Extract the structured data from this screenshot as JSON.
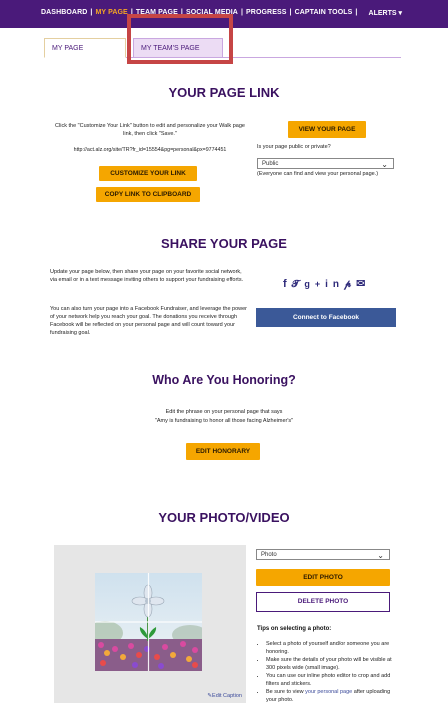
{
  "nav": {
    "items": [
      "DASHBOARD",
      "MY PAGE",
      "TEAM PAGE",
      "SOCIAL MEDIA",
      "PROGRESS",
      "CAPTAIN TOOLS"
    ],
    "alerts": "ALERTS ▾"
  },
  "tabs": [
    "MY PAGE",
    "MY TEAM'S PAGE"
  ],
  "page_link": {
    "title": "YOUR PAGE LINK",
    "instructions": "Click the \"Customize Your Link\" button to edit and personalize your Walk page link, then click \"Save.\"",
    "url": "http://act.alz.org/site/TR?fr_id=15554&pg=personal&px=9774451",
    "customize_btn": "CUSTOMIZE YOUR LINK",
    "copy_btn": "COPY LINK TO CLIPBOARD",
    "view_btn": "VIEW YOUR PAGE",
    "privacy_label": "Is your page public or private?",
    "privacy_value": "Public",
    "privacy_note": "(Everyone can find and view your personal page.)"
  },
  "share": {
    "title": "SHARE YOUR PAGE",
    "para1": "Update your page below, then share your page on your favorite social network, via email or in a text message inviting others to support your fundraising efforts.",
    "para2": "You can also turn your page into a Facebook Fundraiser, and leverage the power of your network help you reach your goal. The donations you receive through Facebook will be reflected on your personal page and will count toward your fundraising goal.",
    "social_icons": [
      "facebook-icon",
      "twitter-icon",
      "google-plus-icon",
      "linkedin-icon",
      "pinterest-icon",
      "email-icon"
    ],
    "social_glyphs": "f 𝕥 g+ in 𝓅 ✉",
    "fb_btn": "Connect to Facebook"
  },
  "honor": {
    "title": "Who Are You Honoring?",
    "desc1": "Edit the phrase on your personal page that says",
    "desc2": "\"Amy is fundraising to honor all those facing Alzheimer's\"",
    "btn": "EDIT HONORARY"
  },
  "photo": {
    "title": "YOUR PHOTO/VIDEO",
    "select_value": "Photo",
    "edit_btn": "EDIT PHOTO",
    "delete_btn": "DELETE PHOTO",
    "edit_caption": "✎Edit Caption",
    "tips_title": "Tips on selecting a photo:",
    "tips": [
      "Select a photo of yourself and/or someone you are honoring.",
      "Make sure the details of your photo will be visible at 300 pixels wide (small image).",
      "You can use our inline photo editor to crop and add filters and stickers."
    ],
    "tip_last_pre": "Be sure to view ",
    "tip_last_link": "your personal page",
    "tip_last_post": " after uploading your photo."
  }
}
